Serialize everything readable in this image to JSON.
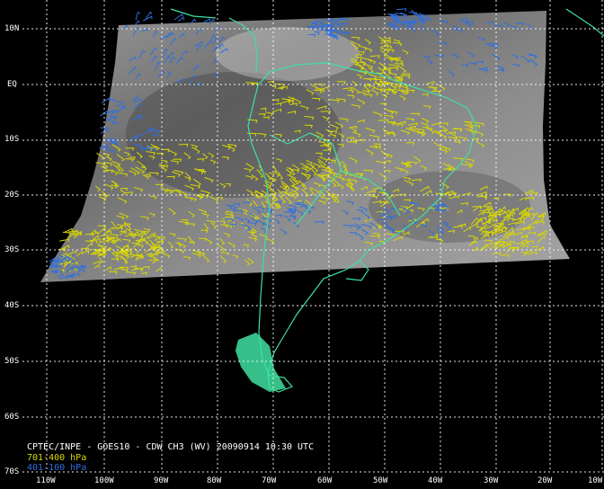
{
  "image": {
    "caption_title": "CPTEC/INPE - GOES10 - CDW CH3 (WV) 20090914 10:30 UTC",
    "legend": [
      {
        "label": "701-400 hPa",
        "color": "#d8d800"
      },
      {
        "label": "401-100 hPa",
        "color": "#2f6fe0"
      }
    ]
  },
  "colors": {
    "background": "#000000",
    "grid": "#ffffff",
    "coastline": "#3fe0a0",
    "satellite_gray": "#8a8a8a",
    "label_text": "#ffffff"
  },
  "map": {
    "lat_labels": [
      "10N",
      "EQ",
      "10S",
      "20S",
      "30S",
      "40S",
      "50S",
      "60S",
      "70S"
    ],
    "lon_labels": [
      "110W",
      "100W",
      "90W",
      "80W",
      "70W",
      "60W",
      "50W",
      "40W",
      "30W",
      "20W",
      "10W"
    ]
  }
}
